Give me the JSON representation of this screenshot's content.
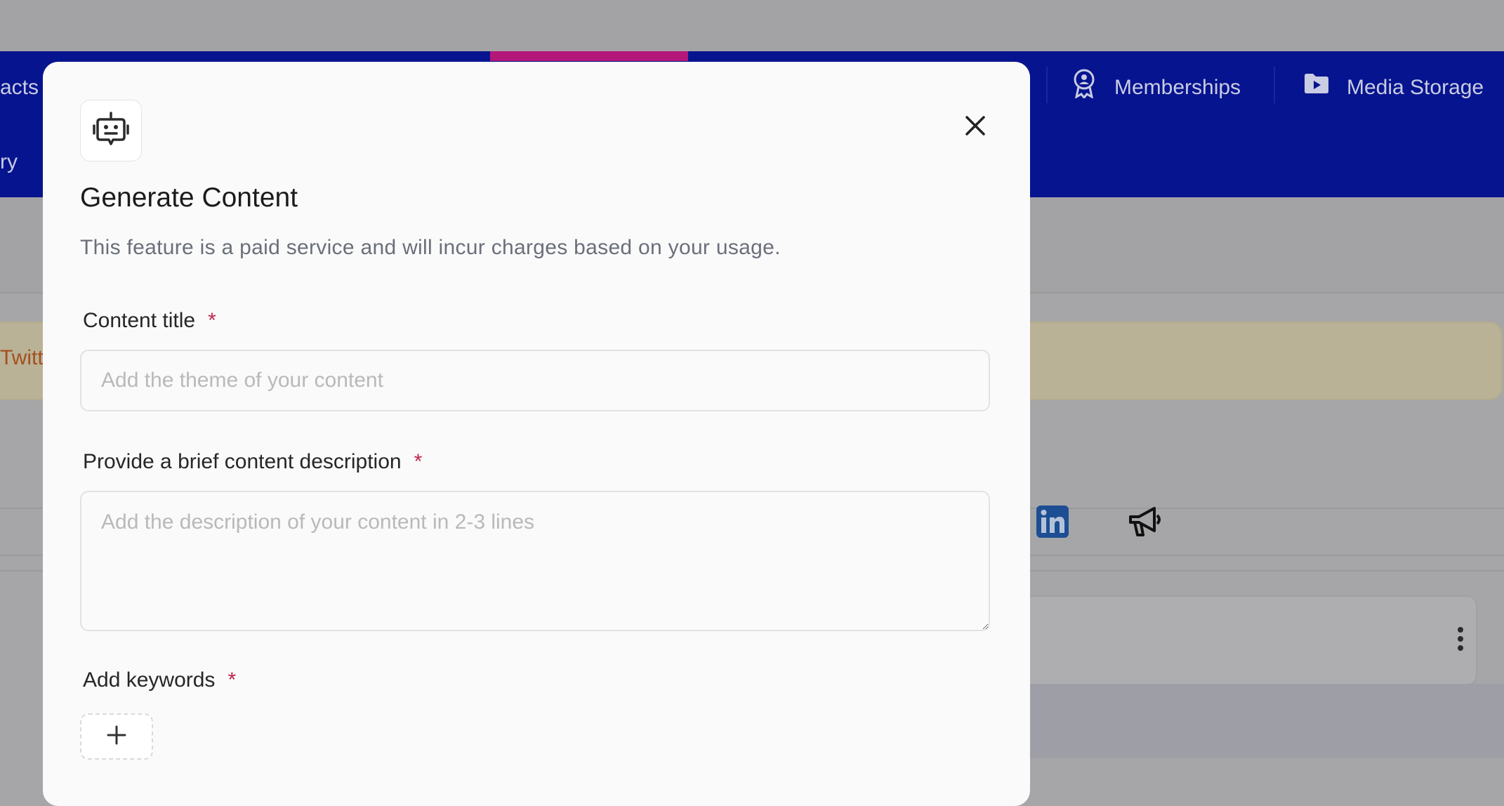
{
  "background": {
    "nav_items": [
      {
        "label": "acts",
        "icon": null
      },
      {
        "label": "Memberships",
        "icon": "membership-badge-icon"
      },
      {
        "label": "Media Storage",
        "icon": "media-folder-icon"
      }
    ],
    "nav_row2_label": "ry",
    "banner_text": "Twitt",
    "social_icons": [
      "linkedin-icon",
      "megaphone-icon"
    ],
    "card_menu_icon": "more-vertical-icon",
    "colors": {
      "nav": "#07148f",
      "accent": "#b3177a",
      "banner_text": "#a4501d"
    }
  },
  "modal": {
    "icon": "robot-icon",
    "title": "Generate Content",
    "subtitle": "This feature is a paid service and will incur charges based on your usage.",
    "fields": {
      "content_title": {
        "label": "Content title",
        "required_mark": "*",
        "placeholder": "Add the theme of your content",
        "value": ""
      },
      "description": {
        "label": "Provide a brief content description",
        "required_mark": "*",
        "placeholder": "Add the description of your content in 2-3 lines",
        "value": ""
      },
      "keywords": {
        "label": "Add keywords",
        "required_mark": "*",
        "add_icon": "plus-icon"
      }
    },
    "close_icon": "close-icon"
  }
}
